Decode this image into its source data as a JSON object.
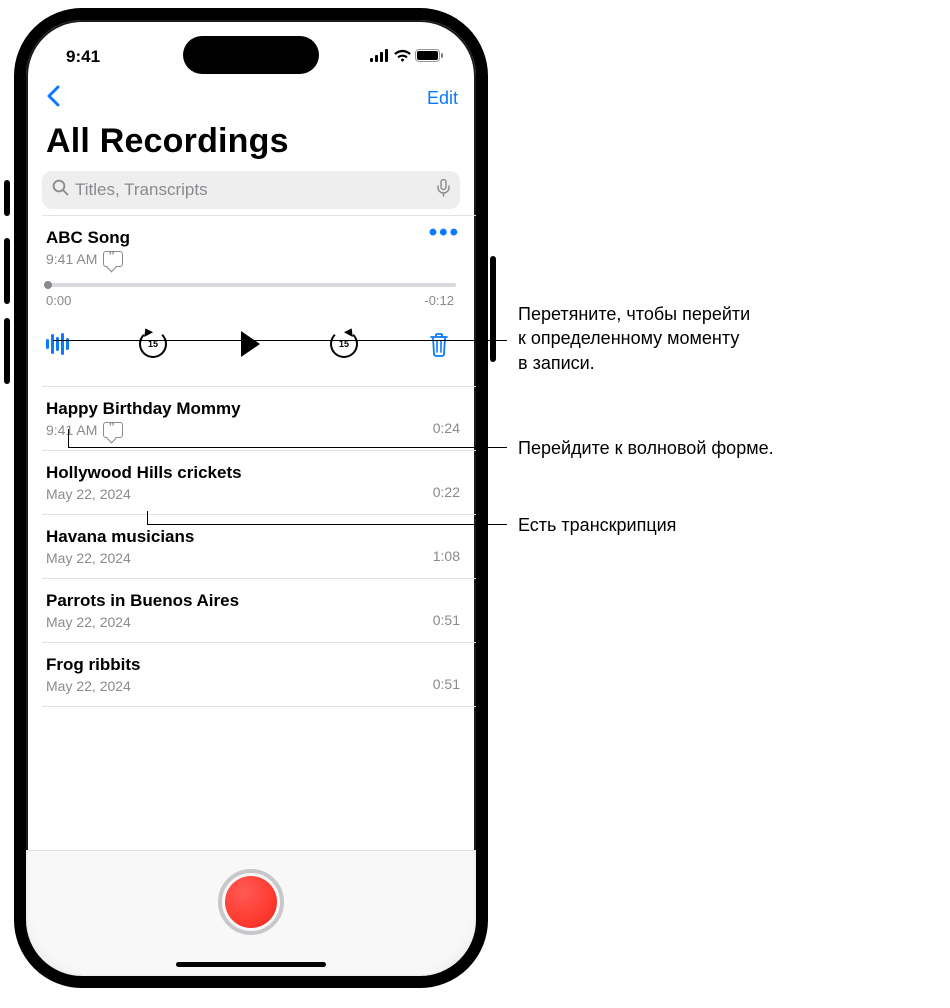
{
  "status": {
    "time": "9:41"
  },
  "nav": {
    "edit": "Edit"
  },
  "title": "All Recordings",
  "search": {
    "placeholder": "Titles, Transcripts"
  },
  "expanded": {
    "title": "ABC Song",
    "subtitle": "9:41 AM",
    "time_start": "0:00",
    "time_end": "-0:12",
    "skip_label": "15"
  },
  "recordings": [
    {
      "title": "Happy Birthday Mommy",
      "subtitle": "9:41 AM",
      "duration": "0:24",
      "transcript": true
    },
    {
      "title": "Hollywood Hills crickets",
      "subtitle": "May 22, 2024",
      "duration": "0:22",
      "transcript": false
    },
    {
      "title": "Havana musicians",
      "subtitle": "May 22, 2024",
      "duration": "1:08",
      "transcript": false
    },
    {
      "title": "Parrots in Buenos Aires",
      "subtitle": "May 22, 2024",
      "duration": "0:51",
      "transcript": false
    },
    {
      "title": "Frog ribbits",
      "subtitle": "May 22, 2024",
      "duration": "0:51",
      "transcript": false
    }
  ],
  "callouts": {
    "c1": "Перетяните, чтобы перейти к определенному моменту в записи.",
    "c2": "Перейдите к волновой форме.",
    "c3": "Есть транскрипция"
  }
}
